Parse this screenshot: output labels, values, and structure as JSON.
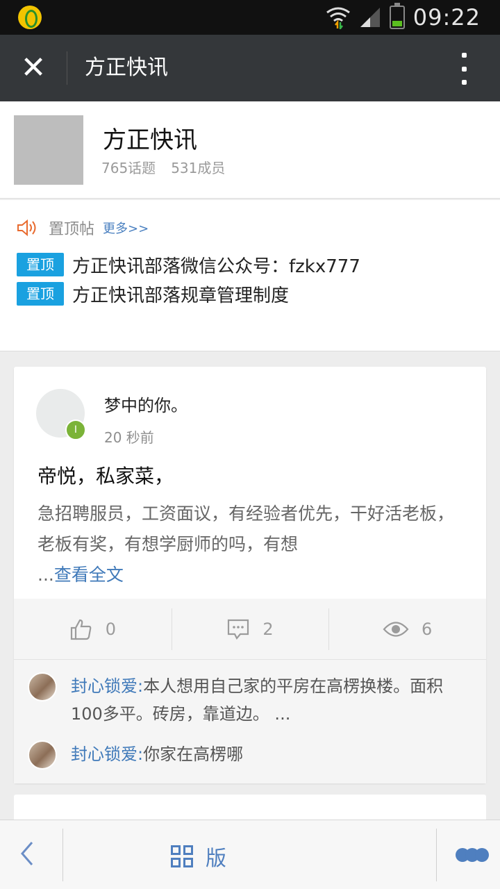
{
  "status_bar": {
    "time": "09:22"
  },
  "nav": {
    "title": "方正快讯",
    "close_icon": "close-icon",
    "more_icon": "more-vertical-icon"
  },
  "group": {
    "name": "方正快讯",
    "topics": "765话题",
    "members": "531成员"
  },
  "pinned": {
    "label": "置顶帖",
    "more": "更多>>",
    "items": [
      {
        "badge": "置顶",
        "text": "方正快讯部落微信公众号：fzkx777"
      },
      {
        "badge": "置顶",
        "text": "方正快讯部落规章管理制度"
      }
    ]
  },
  "post": {
    "author": "梦中的你。",
    "level": "I",
    "time": "20 秒前",
    "title": "帝悦，私家菜，",
    "body": "急招聘服员，工资面议，有经验者优先，干好活老板，老板有奖，有想学厨师的吗，有想",
    "ellipsis": "...",
    "read_more": "查看全文",
    "likes": "0",
    "comments_count": "2",
    "views": "6",
    "comments": [
      {
        "name": "封心锁爱",
        "sep": ":",
        "text": "本人想用自己家的平房在高楞换楼。面积100多平。砖房，靠道边。 ..."
      },
      {
        "name": "封心锁爱",
        "sep": ":",
        "text": "你家在高楞哪"
      }
    ]
  },
  "bottom_bar": {
    "back_icon": "chevron-left-icon",
    "board_label": "版",
    "more_icon": "more-dots-icon"
  },
  "colors": {
    "nav_bg": "#34373a",
    "accent_blue": "#1aa1e0",
    "link_blue": "#3f79b9",
    "level_green": "#7bb338"
  }
}
